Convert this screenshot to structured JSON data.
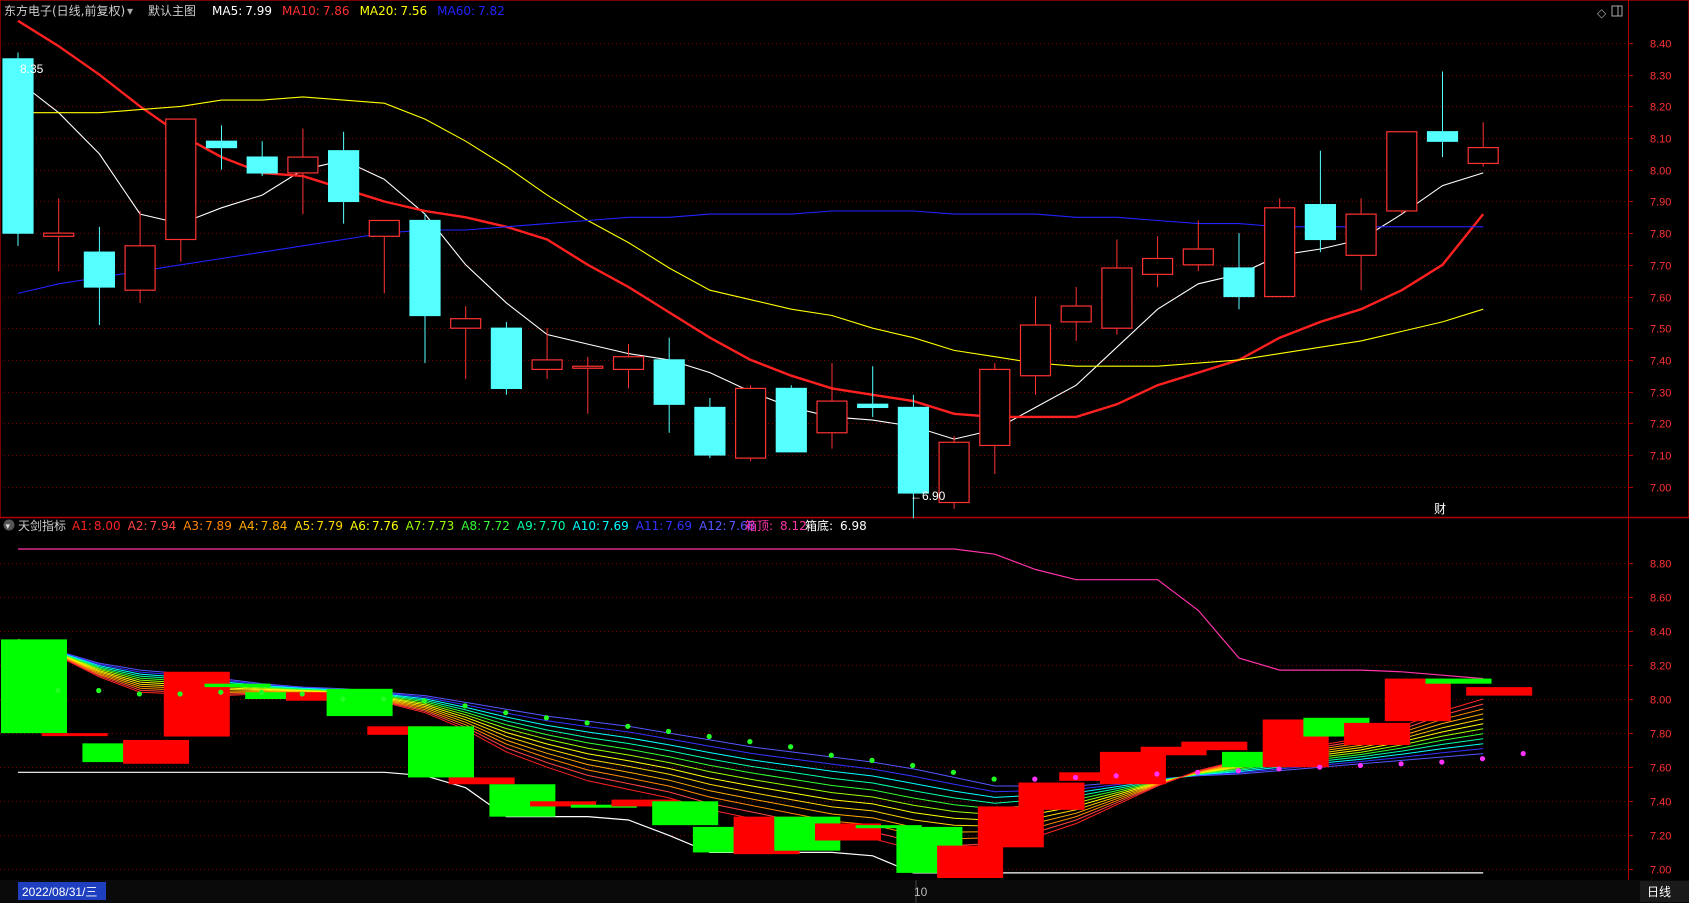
{
  "header": {
    "stock": "东方电子(日线,前复权)",
    "main_chart": "默认主图",
    "ma": [
      {
        "label": "MA5:",
        "value": "7.99",
        "color": "#ffffff"
      },
      {
        "label": "MA10:",
        "value": "7.86",
        "color": "#ff3030"
      },
      {
        "label": "MA20:",
        "value": "7.56",
        "color": "#ffff00"
      },
      {
        "label": "MA60:",
        "value": "7.82",
        "color": "#2222ff"
      }
    ]
  },
  "indicator": {
    "name": "天剑指标",
    "items": [
      {
        "label": "A1:",
        "value": "8.00",
        "color": "#ff2222"
      },
      {
        "label": "A2:",
        "value": "7.94",
        "color": "#ff4444"
      },
      {
        "label": "A3:",
        "value": "7.89",
        "color": "#ff8800"
      },
      {
        "label": "A4:",
        "value": "7.84",
        "color": "#ffaa00"
      },
      {
        "label": "A5:",
        "value": "7.79",
        "color": "#ffd700"
      },
      {
        "label": "A6:",
        "value": "7.76",
        "color": "#ffff00"
      },
      {
        "label": "A7:",
        "value": "7.73",
        "color": "#99ff00"
      },
      {
        "label": "A8:",
        "value": "7.72",
        "color": "#33ff33"
      },
      {
        "label": "A9:",
        "value": "7.70",
        "color": "#00ffaa"
      },
      {
        "label": "A10:",
        "value": "7.69",
        "color": "#00ffff"
      },
      {
        "label": "A11:",
        "value": "7.69",
        "color": "#3333ff"
      },
      {
        "label": "A12:",
        "value": "7.68",
        "color": "#5555ff"
      }
    ],
    "top_label": "箱顶:",
    "top_value": "8.12",
    "top_color": "#ff33aa",
    "bottom_label": "箱底:",
    "bottom_value": "6.98",
    "bottom_color": "#ffffff"
  },
  "bottom_bar": {
    "date": "2022/08/31/三",
    "month_marker": "10",
    "period": "日线"
  },
  "annotations": {
    "high": "8.35",
    "low": "←6.90",
    "fin_marker": "财"
  },
  "colors": {
    "up": "#ff3232",
    "down": "#54ffff",
    "ind_up": "#ff0000",
    "ind_down": "#00ff00",
    "grid": "#7a0000",
    "axis_text": "#ff3333"
  },
  "chart_data": [
    {
      "type": "candlestick",
      "title": "东方电子(日线,前复权)",
      "ylim": [
        6.92,
        8.46
      ],
      "yticks": [
        "8.40",
        "8.30",
        "8.20",
        "8.10",
        "8.00",
        "7.90",
        "7.80",
        "7.70",
        "7.60",
        "7.50",
        "7.40",
        "7.30",
        "7.20",
        "7.10",
        "7.00"
      ],
      "candles": [
        {
          "o": 8.35,
          "h": 8.37,
          "l": 7.76,
          "c": 7.8
        },
        {
          "o": 7.79,
          "h": 7.91,
          "l": 7.68,
          "c": 7.8
        },
        {
          "o": 7.74,
          "h": 7.82,
          "l": 7.51,
          "c": 7.63
        },
        {
          "o": 7.62,
          "h": 7.87,
          "l": 7.58,
          "c": 7.76
        },
        {
          "o": 7.78,
          "h": 8.16,
          "l": 7.71,
          "c": 8.16
        },
        {
          "o": 8.09,
          "h": 8.14,
          "l": 8.0,
          "c": 8.07
        },
        {
          "o": 8.04,
          "h": 8.09,
          "l": 7.98,
          "c": 7.99
        },
        {
          "o": 7.99,
          "h": 8.13,
          "l": 7.86,
          "c": 8.04
        },
        {
          "o": 8.06,
          "h": 8.12,
          "l": 7.83,
          "c": 7.9
        },
        {
          "o": 7.79,
          "h": 7.84,
          "l": 7.61,
          "c": 7.84
        },
        {
          "o": 7.84,
          "h": 7.86,
          "l": 7.39,
          "c": 7.54
        },
        {
          "o": 7.5,
          "h": 7.57,
          "l": 7.34,
          "c": 7.53
        },
        {
          "o": 7.5,
          "h": 7.52,
          "l": 7.29,
          "c": 7.31
        },
        {
          "o": 7.37,
          "h": 7.5,
          "l": 7.34,
          "c": 7.4
        },
        {
          "o": 7.38,
          "h": 7.41,
          "l": 7.23,
          "c": 7.38
        },
        {
          "o": 7.37,
          "h": 7.45,
          "l": 7.31,
          "c": 7.41
        },
        {
          "o": 7.4,
          "h": 7.47,
          "l": 7.17,
          "c": 7.26
        },
        {
          "o": 7.25,
          "h": 7.28,
          "l": 7.09,
          "c": 7.1
        },
        {
          "o": 7.09,
          "h": 7.32,
          "l": 7.08,
          "c": 7.31
        },
        {
          "o": 7.31,
          "h": 7.32,
          "l": 7.11,
          "c": 7.11
        },
        {
          "o": 7.17,
          "h": 7.39,
          "l": 7.12,
          "c": 7.27
        },
        {
          "o": 7.26,
          "h": 7.38,
          "l": 7.22,
          "c": 7.25
        },
        {
          "o": 7.25,
          "h": 7.29,
          "l": 6.9,
          "c": 6.98
        },
        {
          "o": 6.95,
          "h": 7.16,
          "l": 6.93,
          "c": 7.14
        },
        {
          "o": 7.13,
          "h": 7.39,
          "l": 7.04,
          "c": 7.37
        },
        {
          "o": 7.35,
          "h": 7.6,
          "l": 7.29,
          "c": 7.51
        },
        {
          "o": 7.52,
          "h": 7.63,
          "l": 7.46,
          "c": 7.57
        },
        {
          "o": 7.5,
          "h": 7.78,
          "l": 7.48,
          "c": 7.69
        },
        {
          "o": 7.67,
          "h": 7.79,
          "l": 7.63,
          "c": 7.72
        },
        {
          "o": 7.7,
          "h": 7.84,
          "l": 7.68,
          "c": 7.75
        },
        {
          "o": 7.69,
          "h": 7.8,
          "l": 7.56,
          "c": 7.6
        },
        {
          "o": 7.6,
          "h": 7.91,
          "l": 7.6,
          "c": 7.88
        },
        {
          "o": 7.89,
          "h": 8.06,
          "l": 7.74,
          "c": 7.78
        },
        {
          "o": 7.73,
          "h": 7.91,
          "l": 7.62,
          "c": 7.86
        },
        {
          "o": 7.87,
          "h": 8.12,
          "l": 7.86,
          "c": 8.12
        },
        {
          "o": 8.12,
          "h": 8.31,
          "l": 8.04,
          "c": 8.09
        },
        {
          "o": 8.02,
          "h": 8.15,
          "l": 8.01,
          "c": 8.07
        }
      ],
      "series": [
        {
          "name": "MA5",
          "color": "#ffffff",
          "values": [
            8.28,
            8.18,
            8.05,
            7.86,
            7.83,
            7.88,
            7.92,
            8.0,
            8.03,
            7.97,
            7.86,
            7.7,
            7.58,
            7.48,
            7.45,
            7.42,
            7.4,
            7.36,
            7.3,
            7.25,
            7.22,
            7.21,
            7.19,
            7.15,
            7.18,
            7.25,
            7.32,
            7.44,
            7.56,
            7.64,
            7.67,
            7.73,
            7.75,
            7.78,
            7.86,
            7.95,
            7.99
          ]
        },
        {
          "name": "MA10",
          "color": "#ff2020",
          "values": [
            8.47,
            8.39,
            8.3,
            8.2,
            8.11,
            8.04,
            7.99,
            7.98,
            7.94,
            7.9,
            7.87,
            7.85,
            7.82,
            7.78,
            7.7,
            7.63,
            7.55,
            7.47,
            7.4,
            7.35,
            7.31,
            7.29,
            7.27,
            7.23,
            7.22,
            7.22,
            7.22,
            7.26,
            7.32,
            7.36,
            7.4,
            7.47,
            7.52,
            7.56,
            7.62,
            7.7,
            7.86
          ]
        },
        {
          "name": "MA20",
          "color": "#ffff00",
          "values": [
            8.18,
            8.18,
            8.18,
            8.19,
            8.2,
            8.22,
            8.22,
            8.23,
            8.22,
            8.21,
            8.16,
            8.09,
            8.01,
            7.92,
            7.84,
            7.77,
            7.69,
            7.62,
            7.59,
            7.56,
            7.54,
            7.5,
            7.47,
            7.43,
            7.41,
            7.39,
            7.38,
            7.38,
            7.38,
            7.39,
            7.4,
            7.42,
            7.44,
            7.46,
            7.49,
            7.52,
            7.56
          ]
        },
        {
          "name": "MA60",
          "color": "#2222ff",
          "values": [
            7.61,
            7.64,
            7.66,
            7.68,
            7.7,
            7.72,
            7.74,
            7.76,
            7.78,
            7.8,
            7.81,
            7.81,
            7.82,
            7.83,
            7.84,
            7.85,
            7.85,
            7.86,
            7.86,
            7.86,
            7.87,
            7.87,
            7.87,
            7.86,
            7.86,
            7.86,
            7.85,
            7.85,
            7.84,
            7.83,
            7.83,
            7.82,
            7.82,
            7.82,
            7.82,
            7.82,
            7.82
          ]
        }
      ]
    },
    {
      "type": "box-indicator",
      "title": "天剑指标",
      "ylim": [
        6.95,
        8.98
      ],
      "yticks": [
        "8.80",
        "8.60",
        "8.40",
        "8.20",
        "8.00",
        "7.80",
        "7.60",
        "7.40",
        "7.20",
        "7.00"
      ],
      "boxes": [
        {
          "o": 8.35,
          "c": 7.8,
          "up": false
        },
        {
          "o": 7.79,
          "c": 7.8,
          "up": true
        },
        {
          "o": 7.74,
          "c": 7.63,
          "up": false
        },
        {
          "o": 7.62,
          "c": 7.76,
          "up": true
        },
        {
          "o": 7.78,
          "c": 8.16,
          "up": true
        },
        {
          "o": 8.09,
          "c": 8.07,
          "up": false
        },
        {
          "o": 8.04,
          "c": 8.0,
          "up": false
        },
        {
          "o": 7.99,
          "c": 8.04,
          "up": true
        },
        {
          "o": 8.06,
          "c": 7.9,
          "up": false
        },
        {
          "o": 7.79,
          "c": 7.84,
          "up": true
        },
        {
          "o": 7.84,
          "c": 7.54,
          "up": false
        },
        {
          "o": 7.5,
          "c": 7.54,
          "up": true
        },
        {
          "o": 7.5,
          "c": 7.31,
          "up": false
        },
        {
          "o": 7.37,
          "c": 7.4,
          "up": true
        },
        {
          "o": 7.38,
          "c": 7.38,
          "up": false
        },
        {
          "o": 7.37,
          "c": 7.41,
          "up": true
        },
        {
          "o": 7.4,
          "c": 7.26,
          "up": false
        },
        {
          "o": 7.25,
          "c": 7.1,
          "up": false
        },
        {
          "o": 7.09,
          "c": 7.31,
          "up": true
        },
        {
          "o": 7.31,
          "c": 7.11,
          "up": false
        },
        {
          "o": 7.17,
          "c": 7.27,
          "up": true
        },
        {
          "o": 7.26,
          "c": 7.25,
          "up": false
        },
        {
          "o": 7.25,
          "c": 6.98,
          "up": false
        },
        {
          "o": 6.95,
          "c": 7.14,
          "up": true
        },
        {
          "o": 7.13,
          "c": 7.37,
          "up": true
        },
        {
          "o": 7.35,
          "c": 7.51,
          "up": true
        },
        {
          "o": 7.52,
          "c": 7.57,
          "up": true
        },
        {
          "o": 7.5,
          "c": 7.69,
          "up": true
        },
        {
          "o": 7.67,
          "c": 7.72,
          "up": true
        },
        {
          "o": 7.7,
          "c": 7.75,
          "up": true
        },
        {
          "o": 7.69,
          "c": 7.6,
          "up": false
        },
        {
          "o": 7.6,
          "c": 7.88,
          "up": true
        },
        {
          "o": 7.89,
          "c": 7.78,
          "up": false
        },
        {
          "o": 7.73,
          "c": 7.86,
          "up": true
        },
        {
          "o": 7.87,
          "c": 8.12,
          "up": true
        },
        {
          "o": 8.12,
          "c": 8.09,
          "up": false
        },
        {
          "o": 8.07,
          "c": 8.02,
          "up": true
        }
      ],
      "box_top": [
        8.88,
        8.88,
        8.88,
        8.88,
        8.88,
        8.88,
        8.88,
        8.88,
        8.88,
        8.88,
        8.88,
        8.88,
        8.88,
        8.88,
        8.88,
        8.88,
        8.88,
        8.88,
        8.88,
        8.88,
        8.88,
        8.88,
        8.88,
        8.88,
        8.85,
        8.76,
        8.7,
        8.7,
        8.7,
        8.52,
        8.24,
        8.17,
        8.17,
        8.17,
        8.16,
        8.14,
        8.12
      ],
      "box_bottom": [
        7.57,
        7.57,
        7.57,
        7.57,
        7.57,
        7.57,
        7.57,
        7.57,
        7.57,
        7.57,
        7.55,
        7.48,
        7.31,
        7.31,
        7.31,
        7.29,
        7.2,
        7.1,
        7.1,
        7.1,
        7.1,
        7.08,
        6.98,
        6.98,
        6.98,
        6.98,
        6.98,
        6.98,
        6.98,
        6.98,
        6.98,
        6.98,
        6.98,
        6.98,
        6.98,
        6.98,
        6.98
      ],
      "dots": [
        8.05,
        8.05,
        8.03,
        8.03,
        8.04,
        8.04,
        8.03,
        8.0,
        8.0,
        7.99,
        7.96,
        7.92,
        7.89,
        7.86,
        7.84,
        7.81,
        7.78,
        7.75,
        7.72,
        7.67,
        7.64,
        7.61,
        7.57,
        7.53,
        7.53,
        7.54,
        7.55,
        7.56,
        7.57,
        7.58,
        7.59,
        7.6,
        7.61,
        7.62,
        7.63,
        7.65,
        7.68
      ],
      "bands": {
        "A1": [
          8.35,
          8.25,
          8.13,
          8.04,
          8.03,
          8.02,
          8.03,
          8.03,
          8.02,
          7.98,
          7.92,
          7.82,
          7.69,
          7.6,
          7.52,
          7.47,
          7.42,
          7.35,
          7.3,
          7.25,
          7.2,
          7.18,
          7.12,
          7.1,
          7.12,
          7.19,
          7.27,
          7.38,
          7.49,
          7.58,
          7.64,
          7.69,
          7.73,
          7.77,
          7.84,
          7.93,
          8.0
        ],
        "A12": [
          8.35,
          8.28,
          8.21,
          8.17,
          8.15,
          8.12,
          8.09,
          8.07,
          8.06,
          8.04,
          8.02,
          7.98,
          7.94,
          7.9,
          7.87,
          7.84,
          7.8,
          7.76,
          7.72,
          7.69,
          7.66,
          7.63,
          7.59,
          7.54,
          7.49,
          7.49,
          7.49,
          7.51,
          7.53,
          7.55,
          7.56,
          7.58,
          7.6,
          7.62,
          7.64,
          7.66,
          7.68
        ]
      }
    }
  ]
}
